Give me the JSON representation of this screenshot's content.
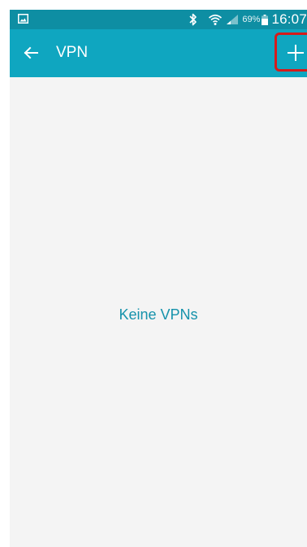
{
  "status_bar": {
    "battery_percent": "69%",
    "time": "16:07",
    "icons": [
      "gallery-notification-icon",
      "bluetooth-icon",
      "wifi-icon",
      "signal-icon",
      "battery-icon"
    ]
  },
  "action_bar": {
    "title": "VPN",
    "back_icon": "arrow-left-icon",
    "add_icon": "plus-icon",
    "highlight_color": "#d51b1b"
  },
  "content": {
    "empty_message": "Keine VPNs"
  },
  "colors": {
    "status_bar": "#0e8ea3",
    "action_bar": "#0fa6c0",
    "background": "#f4f4f4",
    "accent_text": "#1592ab"
  }
}
